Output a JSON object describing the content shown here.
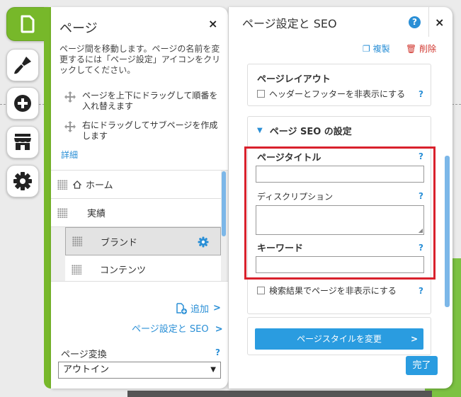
{
  "pages_panel": {
    "title": "ページ",
    "close": "×",
    "description": "ページ間を移動します。ページの名前を変更するには「ページ設定」アイコンをクリックしてください。",
    "tip_reorder": "ページを上下にドラッグして順番を入れ替えます",
    "tip_subpage": "右にドラッグしてサブページを作成します",
    "detail_link": "詳細",
    "pages": [
      {
        "label": "ホーム"
      },
      {
        "label": "実績"
      },
      {
        "label": "ブランド"
      },
      {
        "label": "コンテンツ"
      }
    ],
    "add_label": "追加",
    "seo_link": "ページ設定と SEO",
    "conversion_label": "ページ変換",
    "conversion_value": "アウトイン",
    "help": "?"
  },
  "settings_panel": {
    "title": "ページ設定と SEO",
    "help": "?",
    "close": "×",
    "copy_label": "複製",
    "delete_label": "削除",
    "layout_title": "ページレイアウト",
    "hide_header_footer": "ヘッダーとフッターを非表示にする",
    "seo_section": "ページ SEO の設定",
    "page_title_label": "ページタイトル",
    "description_label": "ディスクリプション",
    "keywords_label": "キーワード",
    "hide_search": "検索結果でページを非表示にする",
    "style_button": "ページスタイルを変更",
    "done_button": "完了"
  },
  "colors": {
    "accent_green": "#77b82a",
    "link_blue": "#2a8fd6",
    "highlight_red": "#d9212c"
  }
}
